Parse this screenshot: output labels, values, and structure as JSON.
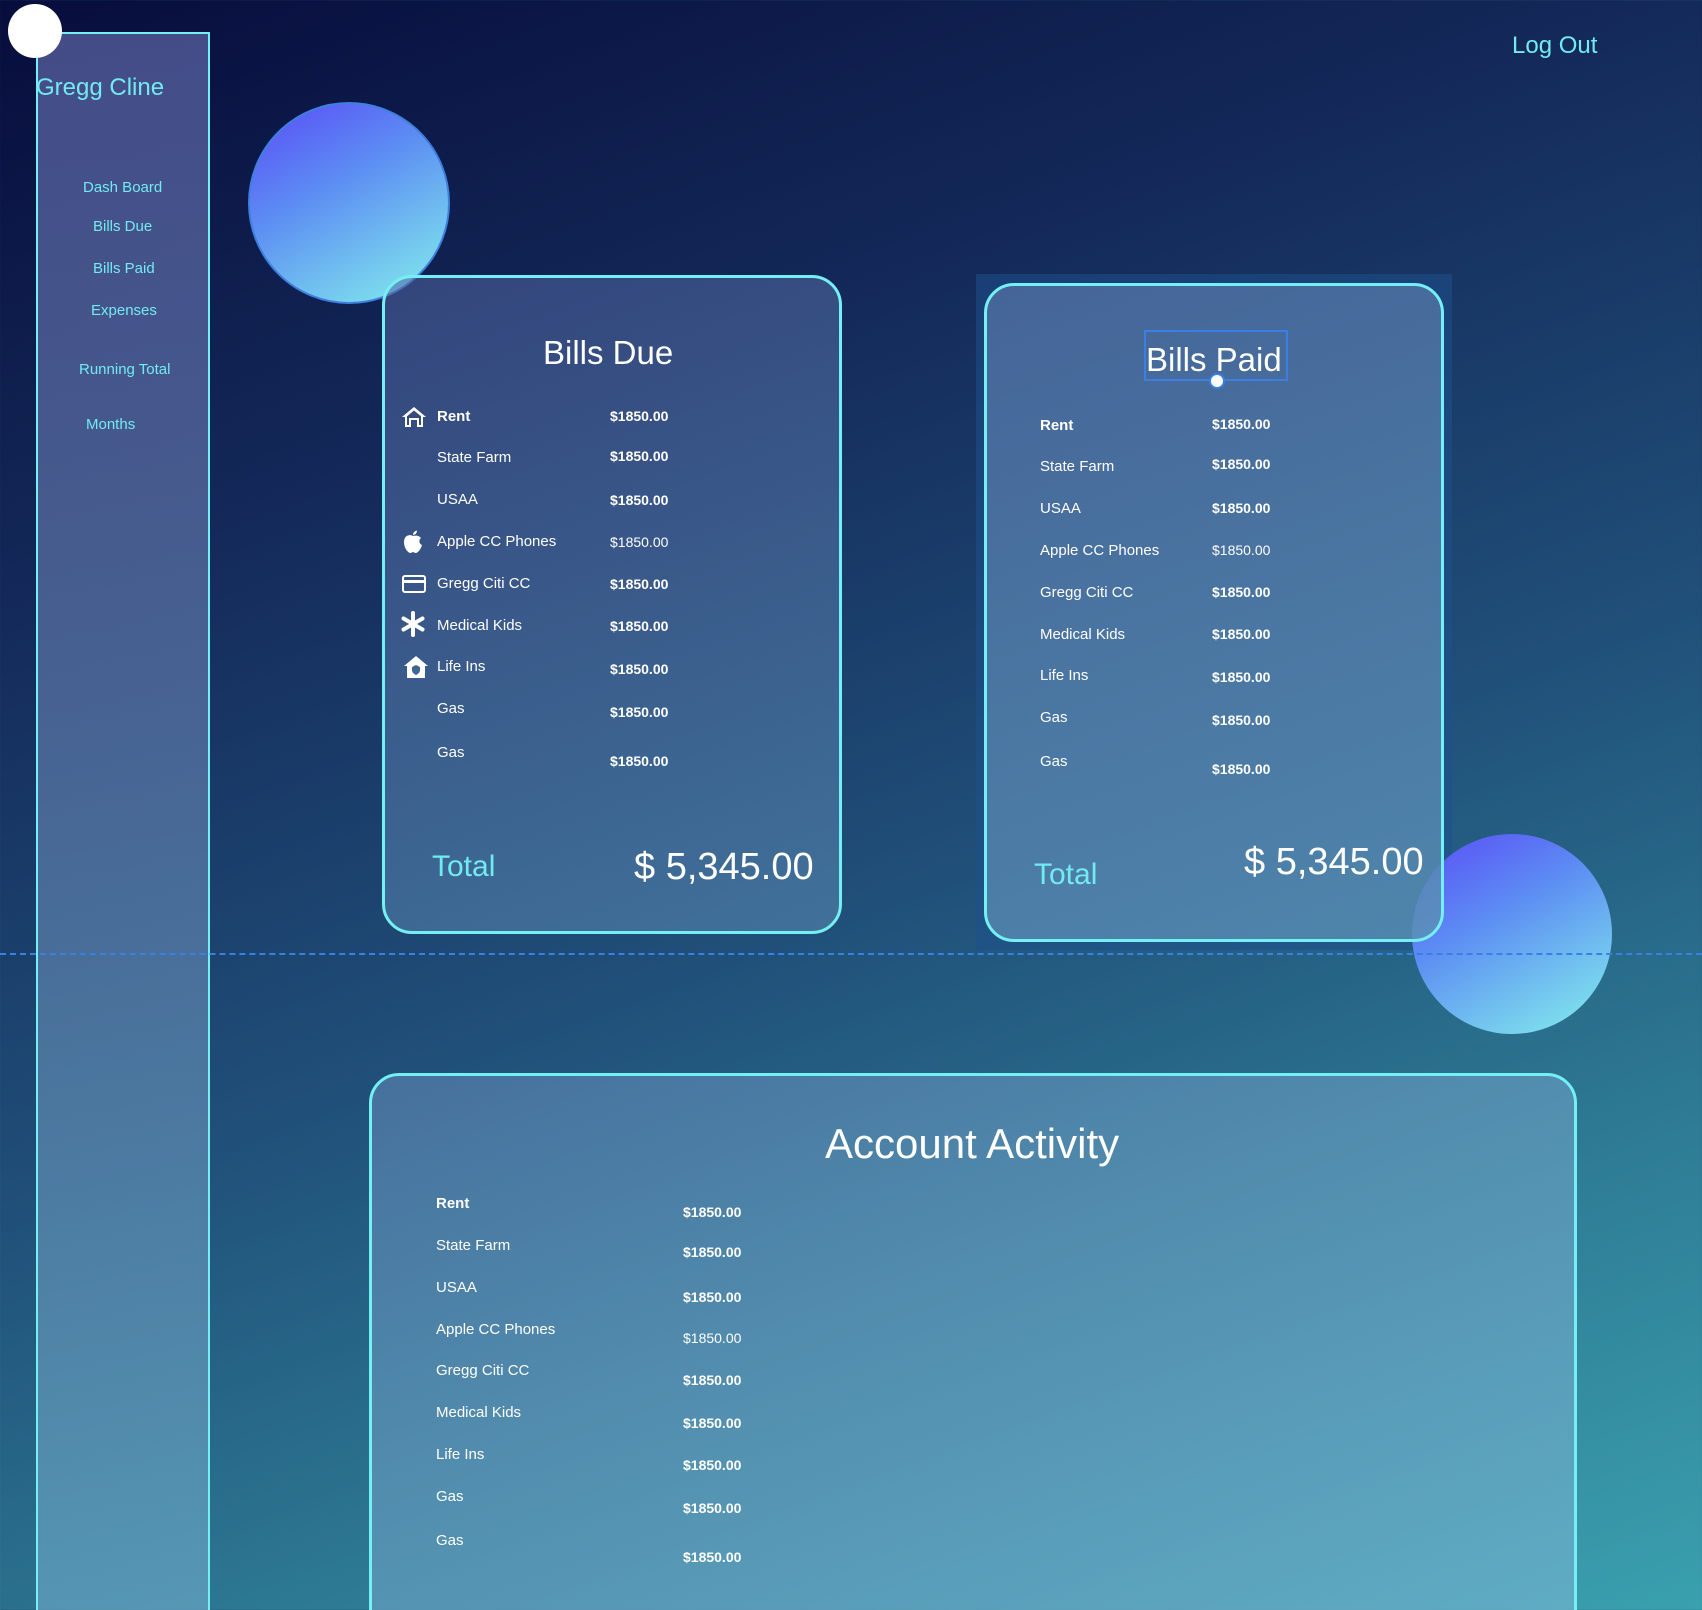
{
  "user": {
    "name": "Gregg Cline"
  },
  "header": {
    "logout_label": "Log Out"
  },
  "sidebar": {
    "items": [
      {
        "label": "Dash Board"
      },
      {
        "label": "Bills Due"
      },
      {
        "label": "Bills Paid"
      },
      {
        "label": "Expenses"
      },
      {
        "label": "Running Total"
      },
      {
        "label": "Months"
      }
    ]
  },
  "bills_due": {
    "title": "Bills Due",
    "rows": [
      {
        "label": "Rent",
        "amount": "$1850.00",
        "icon": "house-icon"
      },
      {
        "label": "State Farm",
        "amount": "$1850.00"
      },
      {
        "label": "USAA",
        "amount": "$1850.00"
      },
      {
        "label": "Apple CC Phones",
        "amount": "$1850.00",
        "icon": "apple-icon"
      },
      {
        "label": "Gregg Citi CC",
        "amount": "$1850.00",
        "icon": "credit-card-icon"
      },
      {
        "label": "Medical Kids",
        "amount": "$1850.00",
        "icon": "asterisk-icon"
      },
      {
        "label": "Life Ins",
        "amount": "$1850.00",
        "icon": "house-shield-icon"
      },
      {
        "label": "Gas",
        "amount": "$1850.00"
      },
      {
        "label": "Gas",
        "amount": "$1850.00"
      }
    ],
    "total_label": "Total",
    "total_amount": "$ 5,345.00"
  },
  "bills_paid": {
    "title": "Bills Paid",
    "rows": [
      {
        "label": "Rent",
        "amount": "$1850.00"
      },
      {
        "label": "State Farm",
        "amount": "$1850.00"
      },
      {
        "label": "USAA",
        "amount": "$1850.00"
      },
      {
        "label": "Apple CC Phones",
        "amount": "$1850.00"
      },
      {
        "label": "Gregg Citi CC",
        "amount": "$1850.00"
      },
      {
        "label": "Medical Kids",
        "amount": "$1850.00"
      },
      {
        "label": "Life Ins",
        "amount": "$1850.00"
      },
      {
        "label": "Gas",
        "amount": "$1850.00"
      },
      {
        "label": "Gas",
        "amount": "$1850.00"
      }
    ],
    "total_label": "Total",
    "total_amount": "$ 5,345.00"
  },
  "account_activity": {
    "title": "Account Activity",
    "rows": [
      {
        "label": "Rent",
        "amount": "$1850.00"
      },
      {
        "label": "State Farm",
        "amount": "$1850.00"
      },
      {
        "label": "USAA",
        "amount": "$1850.00"
      },
      {
        "label": "Apple CC Phones",
        "amount": "$1850.00"
      },
      {
        "label": "Gregg Citi CC",
        "amount": "$1850.00"
      },
      {
        "label": "Medical Kids",
        "amount": "$1850.00"
      },
      {
        "label": "Life Ins",
        "amount": "$1850.00"
      },
      {
        "label": "Gas",
        "amount": "$1850.00"
      },
      {
        "label": "Gas",
        "amount": "$1850.00"
      }
    ]
  },
  "colors": {
    "accent": "#74f0f4",
    "selection": "#3a7fe6",
    "text": "#ffffff"
  }
}
